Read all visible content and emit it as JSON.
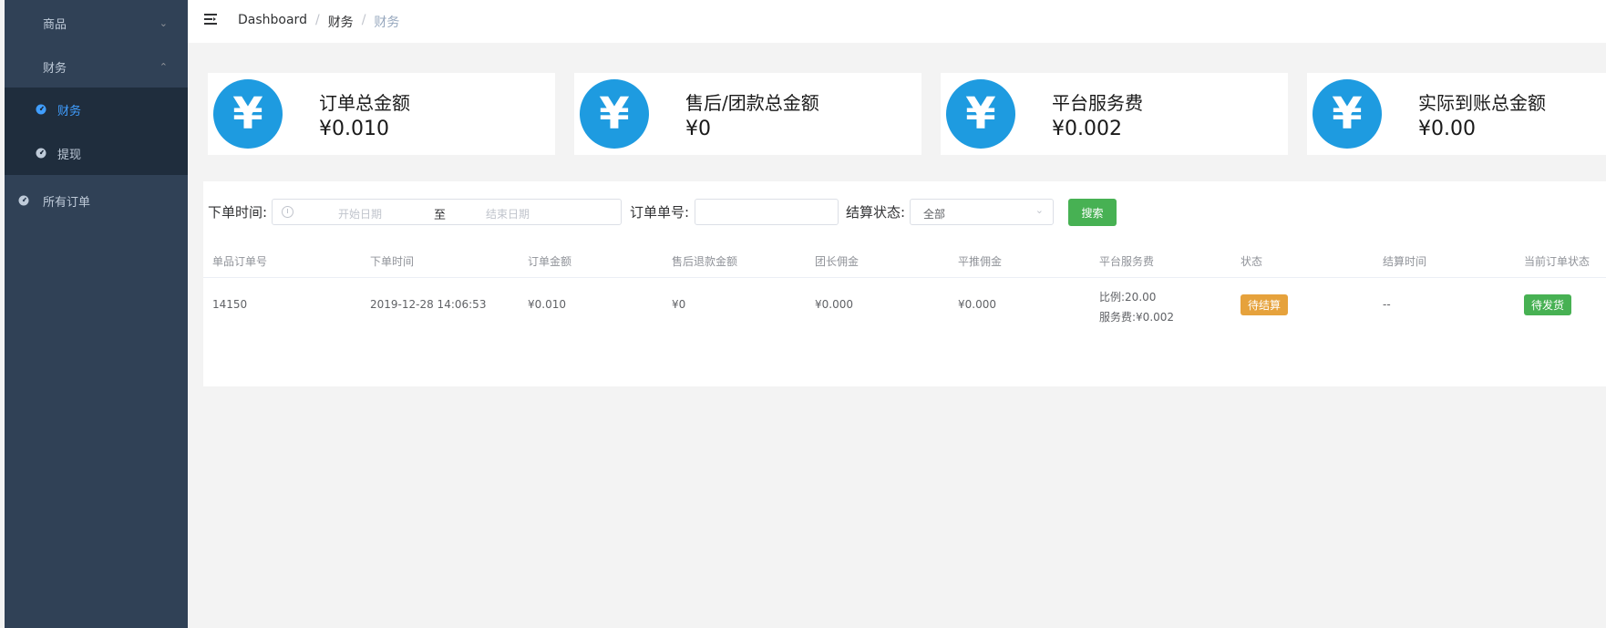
{
  "sidebar": {
    "menu_goods": "商品",
    "menu_finance": "财务",
    "sub_finance": "财务",
    "sub_withdraw": "提现",
    "menu_all_orders": "所有订单"
  },
  "breadcrumb": [
    "Dashboard",
    "财务",
    "财务"
  ],
  "cards": [
    {
      "title": "订单总金额",
      "value": "¥0.010"
    },
    {
      "title": "售后/团款总金额",
      "value": "¥0"
    },
    {
      "title": "平台服务费",
      "value": "¥0.002"
    },
    {
      "title": "实际到账总金额",
      "value": "¥0.00"
    }
  ],
  "yen_symbol": "¥",
  "filters": {
    "time_label": "下单时间:",
    "start_placeholder": "开始日期",
    "range_sep": "至",
    "end_placeholder": "结束日期",
    "order_no_label": "订单单号:",
    "order_no_value": "",
    "status_label": "结算状态:",
    "status_value": "全部",
    "search_button": "搜索"
  },
  "table": {
    "headers": [
      "单品订单号",
      "下单时间",
      "订单金额",
      "售后退款金额",
      "团长佣金",
      "平推佣金",
      "平台服务费",
      "状态",
      "结算时间",
      "当前订单状态"
    ],
    "rows": [
      {
        "order_no": "14150",
        "order_time": "2019-12-28 14:06:53",
        "amount": "¥0.010",
        "refund": "¥0",
        "leader_commission": "¥0.000",
        "push_commission": "¥0.000",
        "fee_ratio": "比例:20.00",
        "fee_amount": "服务费:¥0.002",
        "status": "待结算",
        "settle_time": "--",
        "order_status": "待发货"
      }
    ]
  },
  "colors": {
    "sidebar_bg": "#304156",
    "submenu_bg": "#1f2d3d",
    "active_blue": "#409eff",
    "yen_blue": "#1e9be0",
    "button_green": "#47b153",
    "tag_orange": "#e6a23c"
  },
  "icons": {
    "collapse": "hamburger-icon",
    "finance_sub": "dashboard-icon",
    "withdraw_sub": "dashboard-icon",
    "all_orders": "dashboard-icon",
    "card": "yen-icon"
  }
}
